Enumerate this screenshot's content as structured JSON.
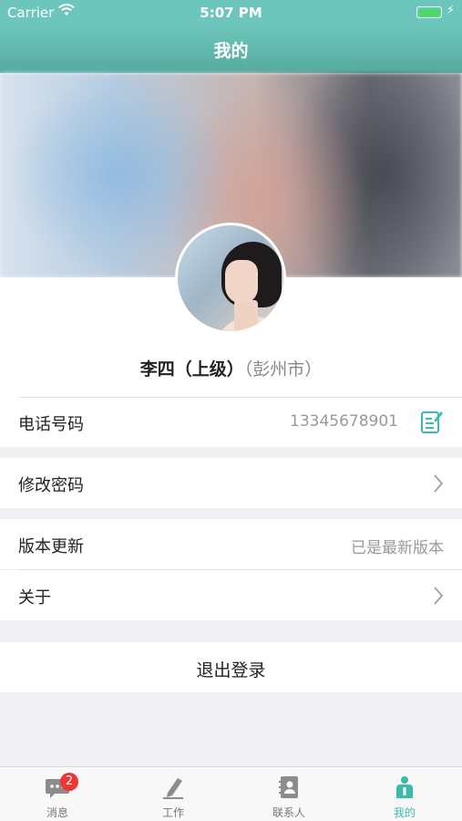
{
  "status_bar": {
    "carrier": "Carrier",
    "time": "5:07 PM"
  },
  "nav": {
    "title": "我的"
  },
  "profile": {
    "name": "李四（上级）",
    "city": "（彭州市）"
  },
  "phone": {
    "label": "电话号码",
    "value": "13345678901",
    "icon": "edit-icon"
  },
  "change_password": {
    "label": "修改密码",
    "icon": "chevron-right-icon"
  },
  "version": {
    "label": "版本更新",
    "value": "已是最新版本"
  },
  "about": {
    "label": "关于",
    "icon": "chevron-right-icon"
  },
  "logout": {
    "label": "退出登录"
  },
  "tabs": [
    {
      "label": "消息",
      "icon": "chat-bubble-icon",
      "badge": "2"
    },
    {
      "label": "工作",
      "icon": "pen-icon"
    },
    {
      "label": "联系人",
      "icon": "contacts-book-icon"
    },
    {
      "label": "我的",
      "icon": "person-icon",
      "active": true
    }
  ],
  "colors": {
    "accent": "#3dbbaa",
    "nav_bar": "#6dc6bb",
    "badge": "#ef3434"
  }
}
